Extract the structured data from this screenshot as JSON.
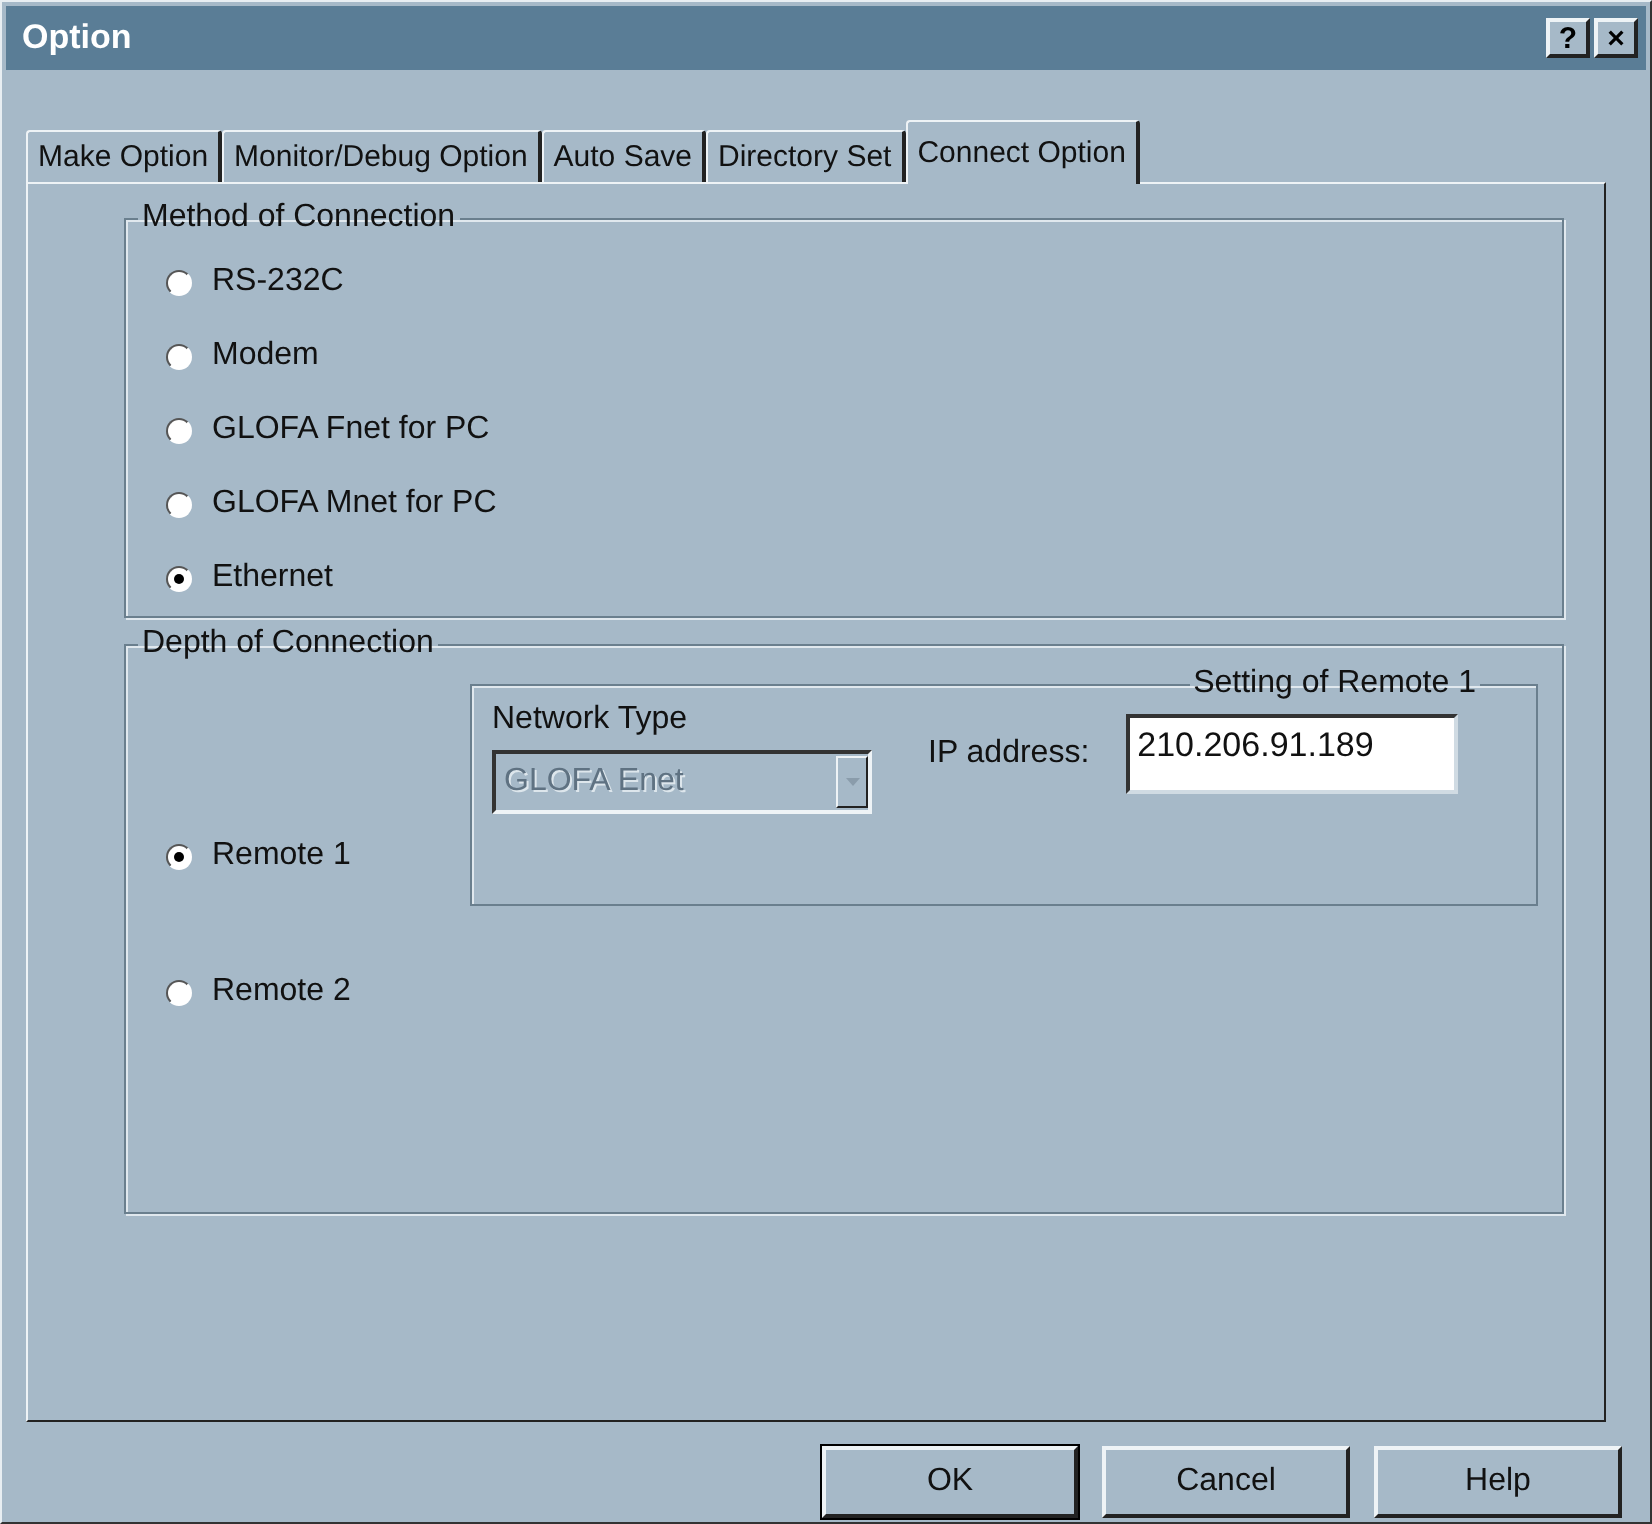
{
  "window": {
    "title": "Option",
    "help_button": "?",
    "close_button": "×"
  },
  "tabs": [
    {
      "label": "Make Option",
      "selected": false
    },
    {
      "label": "Monitor/Debug Option",
      "selected": false
    },
    {
      "label": "Auto Save",
      "selected": false
    },
    {
      "label": "Directory Set",
      "selected": false
    },
    {
      "label": "Connect Option",
      "selected": true
    }
  ],
  "method_group": {
    "title": "Method of Connection",
    "options": [
      {
        "label": "RS-232C",
        "selected": false
      },
      {
        "label": "Modem",
        "selected": false
      },
      {
        "label": "GLOFA Fnet for PC",
        "selected": false
      },
      {
        "label": "GLOFA Mnet for PC",
        "selected": false
      },
      {
        "label": "Ethernet",
        "selected": true
      }
    ]
  },
  "depth_group": {
    "title": "Depth of Connection",
    "options": [
      {
        "label": "Remote 1",
        "selected": true
      },
      {
        "label": "Remote 2",
        "selected": false
      }
    ],
    "setting_group": {
      "title": "Setting of Remote 1",
      "network_type_label": "Network Type",
      "network_type": {
        "value": "GLOFA Enet",
        "disabled": true
      },
      "ip_label": "IP address:",
      "ip_value": "210.206.91.189"
    }
  },
  "buttons": [
    {
      "label": "OK",
      "default": true
    },
    {
      "label": "Cancel",
      "default": false
    },
    {
      "label": "Help",
      "default": false
    }
  ]
}
